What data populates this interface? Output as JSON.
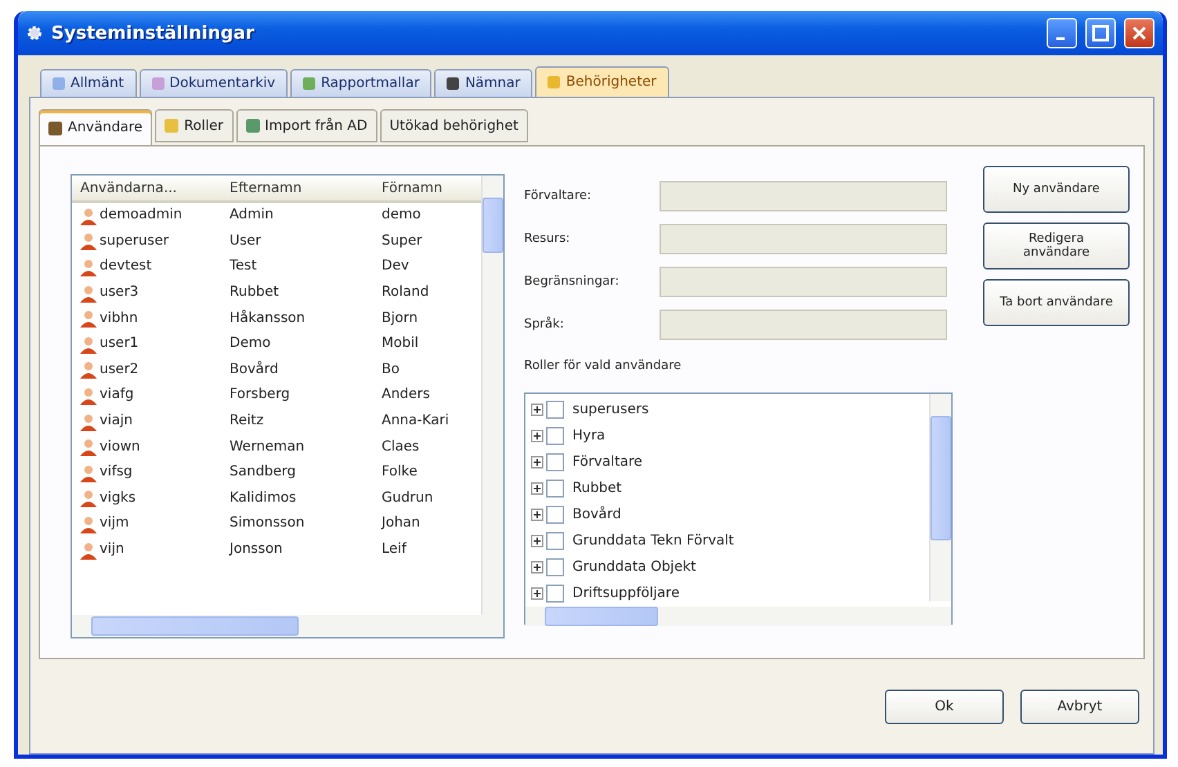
{
  "window": {
    "title": "Systeminställningar"
  },
  "tabs": [
    {
      "label": "Allmänt",
      "selected": false
    },
    {
      "label": "Dokumentarkiv",
      "selected": false
    },
    {
      "label": "Rapportmallar",
      "selected": false
    },
    {
      "label": "Nämnar",
      "selected": false
    },
    {
      "label": "Behörigheter",
      "selected": true
    }
  ],
  "subtabs": [
    {
      "label": "Användare",
      "selected": true
    },
    {
      "label": "Roller",
      "selected": false
    },
    {
      "label": "Import från AD",
      "selected": false
    },
    {
      "label": "Utökad behörighet",
      "selected": false
    }
  ],
  "users": {
    "columns": [
      "Användarna...",
      "Efternamn",
      "Förnamn"
    ],
    "rows": [
      [
        "demoadmin",
        "Admin",
        "demo"
      ],
      [
        "superuser",
        "User",
        "Super"
      ],
      [
        "devtest",
        "Test",
        "Dev"
      ],
      [
        "user3",
        "Rubbet",
        "Roland"
      ],
      [
        "vibhn",
        "Håkansson",
        "Bjorn"
      ],
      [
        "user1",
        "Demo",
        "Mobil"
      ],
      [
        "user2",
        "Bovård",
        "Bo"
      ],
      [
        "viafg",
        "Forsberg",
        "Anders"
      ],
      [
        "viajn",
        "Reitz",
        "Anna-Kari"
      ],
      [
        "viown",
        "Werneman",
        "Claes"
      ],
      [
        "vifsg",
        "Sandberg",
        "Folke"
      ],
      [
        "vigks",
        "Kalidimos",
        "Gudrun"
      ],
      [
        "vijm",
        "Simonsson",
        "Johan"
      ],
      [
        "vijn",
        "Jonsson",
        "Leif"
      ]
    ]
  },
  "fields": [
    {
      "label": "Förvaltare:"
    },
    {
      "label": "Resurs:"
    },
    {
      "label": "Begränsningar:"
    },
    {
      "label": "Språk:"
    }
  ],
  "roles": {
    "label": "Roller för vald användare",
    "items": [
      {
        "label": "superusers",
        "checked": false
      },
      {
        "label": "Hyra",
        "checked": false
      },
      {
        "label": "Förvaltare",
        "checked": false
      },
      {
        "label": "Rubbet",
        "checked": false
      },
      {
        "label": "Bovård",
        "checked": false
      },
      {
        "label": "Grunddata Tekn Förvalt",
        "checked": false
      },
      {
        "label": "Grunddata Objekt",
        "checked": false
      },
      {
        "label": "Driftsuppföljare",
        "checked": false
      }
    ]
  },
  "side_buttons": [
    "Ny användare",
    "Redigera användare",
    "Ta bort användare"
  ],
  "footer_buttons": [
    "Ok",
    "Avbryt"
  ]
}
